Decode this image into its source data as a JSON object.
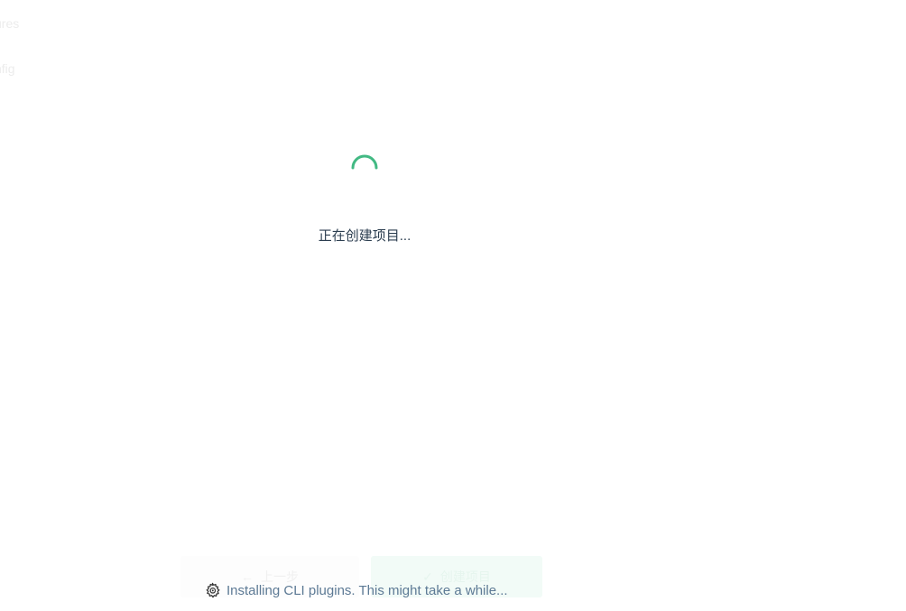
{
  "sidebar": {
    "items": [
      {
        "label": "ures"
      },
      {
        "label": "nfig"
      }
    ]
  },
  "loading": {
    "message": "正在创建项目...",
    "spinner_color": "#42b983"
  },
  "footer": {
    "prev_label": "上一步",
    "create_label": "创建项目"
  },
  "status": {
    "icon": "gear-icon",
    "message": "Installing CLI plugins. This might take a while..."
  }
}
